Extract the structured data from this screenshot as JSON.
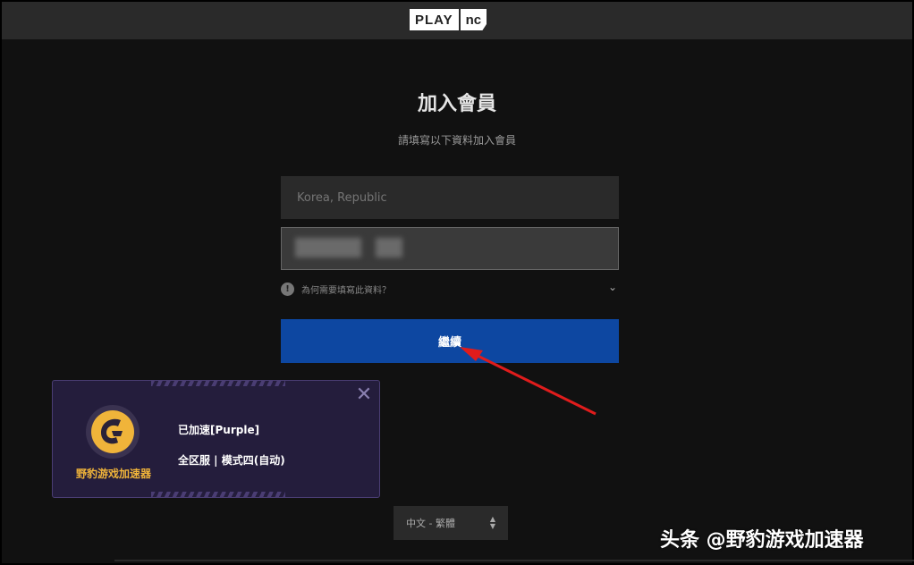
{
  "header": {
    "logo_left": "PLAY",
    "logo_right": "nc"
  },
  "form": {
    "title": "加入會員",
    "subtitle": "請填寫以下資料加入會員",
    "country_placeholder": "Korea, Republic",
    "help_text": "為何需要填寫此資料？",
    "continue_label": "繼續"
  },
  "language": {
    "selected": "中文 - 繁體"
  },
  "accelerator_popup": {
    "brand": "野豹游戏加速器",
    "status": "已加速[Purple]",
    "mode": "全区服 | 模式四(自动)",
    "close_glyph": "✕",
    "accent_color": "#f0b43a"
  },
  "watermark": {
    "text": "头条 @野豹游戏加速器"
  },
  "colors": {
    "button_blue": "#0d47a1",
    "arrow_red": "#e01c1c"
  }
}
